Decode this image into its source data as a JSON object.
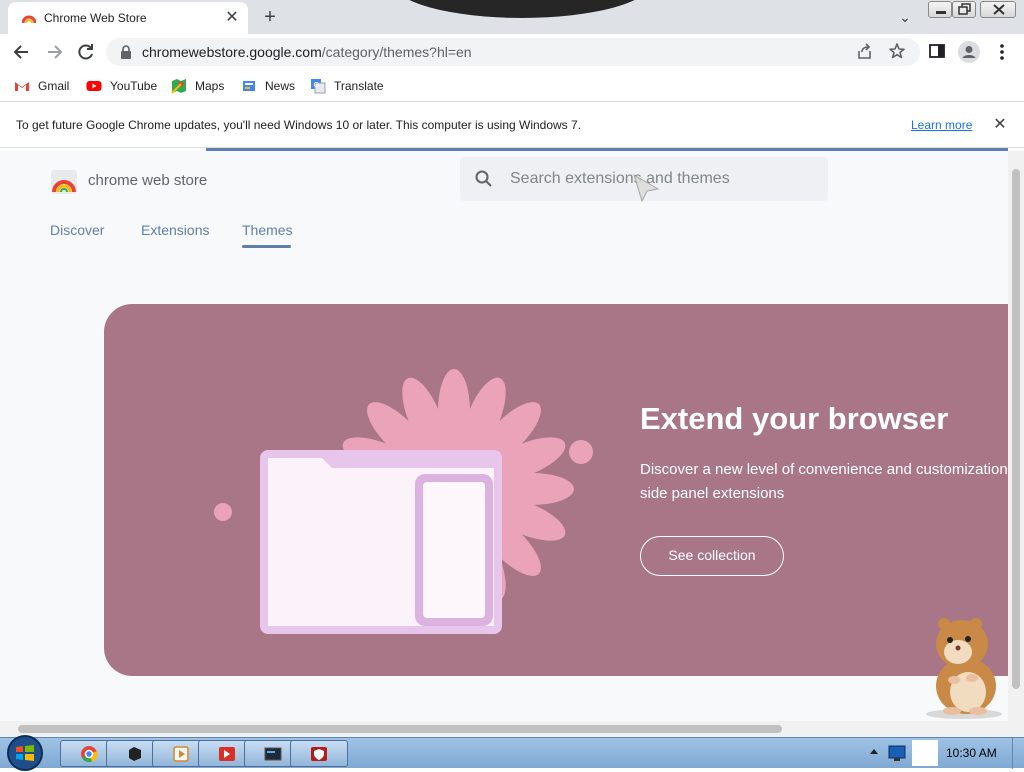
{
  "browser": {
    "tab_title": "Chrome Web Store",
    "new_tab_symbol": "+",
    "tab_close_symbol": "✕",
    "tab_search_symbol": "⌄",
    "url_host": "chromewebstore.google.com",
    "url_path": "/category/themes?hl=en",
    "bookmarks": [
      {
        "label": "Gmail",
        "icon": "gmail-icon"
      },
      {
        "label": "YouTube",
        "icon": "youtube-icon"
      },
      {
        "label": "Maps",
        "icon": "maps-icon"
      },
      {
        "label": "News",
        "icon": "news-icon"
      },
      {
        "label": "Translate",
        "icon": "translate-icon"
      }
    ]
  },
  "infobar": {
    "message": "To get future Google Chrome updates, you'll need Windows 10 or later. This computer is using Windows 7.",
    "link": "Learn more",
    "close_symbol": "✕"
  },
  "store": {
    "name": "chrome web store",
    "search_placeholder": "Search extensions and themes",
    "tabs": [
      "Discover",
      "Extensions",
      "Themes"
    ],
    "active_tab": "Themes"
  },
  "hero": {
    "title": "Extend your browser",
    "subtitle": "Discover a new level of convenience and customization with side panel extensions",
    "button": "See collection",
    "background": "#a87686"
  },
  "taskbar": {
    "clock": "10:30 AM",
    "apps": [
      "chrome-icon",
      "window-icon",
      "media-icon",
      "presentation-icon",
      "terminal-icon",
      "shield-icon"
    ]
  },
  "colors": {
    "accent": "#5f7fa8",
    "link": "#1a73e8"
  }
}
